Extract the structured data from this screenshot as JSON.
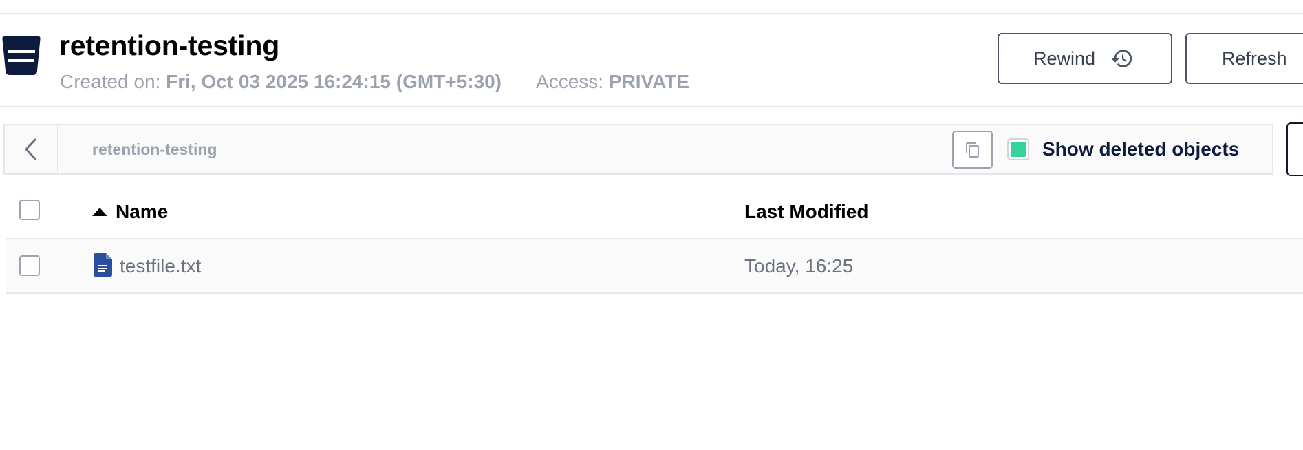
{
  "bucket": {
    "title": "retention-testing",
    "created_label": "Created on:",
    "created_value": "Fri, Oct 03 2025 16:24:15 (GMT+5:30)",
    "access_label": "Access:",
    "access_value": "PRIVATE"
  },
  "actions": {
    "rewind_label": "Rewind",
    "refresh_label": "Refresh"
  },
  "path_bar": {
    "path": "retention-testing",
    "show_deleted_label": "Show deleted objects",
    "show_deleted_checked": true
  },
  "table": {
    "columns": [
      "Name",
      "Last Modified"
    ],
    "sort": "Name ascending",
    "rows": [
      {
        "name": "testfile.txt",
        "last_modified": "Today, 16:25"
      }
    ]
  },
  "colors": {
    "brand_dark": "#0f1b3d",
    "toggle_green": "#34d399",
    "file_icon_blue": "#2b4f9c",
    "muted_text": "#9ca3af"
  },
  "icons": [
    "bucket-icon",
    "history-icon",
    "chevron-left-icon",
    "copy-icon",
    "sort-up-icon",
    "text-file-icon"
  ]
}
